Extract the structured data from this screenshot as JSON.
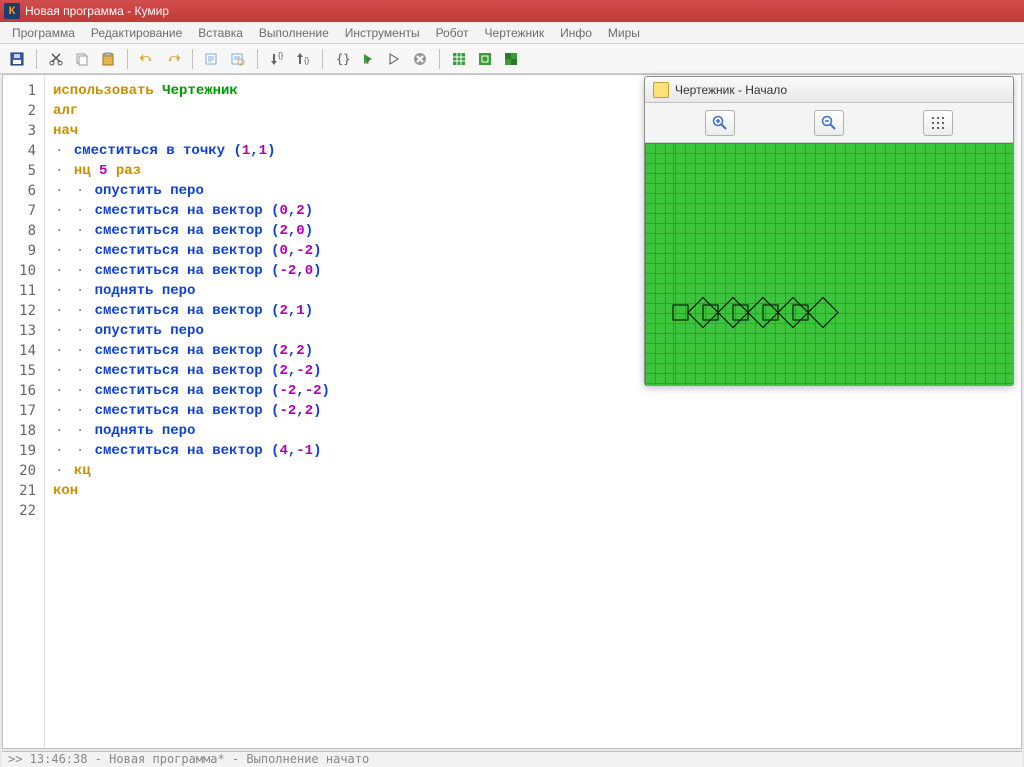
{
  "titlebar": {
    "icon_letter": "К",
    "title": "Новая программа - Кумир"
  },
  "menu": [
    "Программа",
    "Редактирование",
    "Вставка",
    "Выполнение",
    "Инструменты",
    "Робот",
    "Чертежник",
    "Инфо",
    "Миры"
  ],
  "toolbar_icons": [
    "save",
    "cut",
    "copy",
    "paste",
    "undo",
    "redo",
    "find",
    "replace",
    "step-into",
    "step-over",
    "braces",
    "run",
    "run-sel",
    "stop",
    "grid1",
    "grid2",
    "grid3"
  ],
  "code": {
    "lines": [
      {
        "n": 1,
        "tokens": [
          {
            "t": "kw",
            "v": "использовать "
          },
          {
            "t": "kw2",
            "v": "Чертежник"
          }
        ]
      },
      {
        "n": 2,
        "tokens": [
          {
            "t": "kw",
            "v": "алг"
          }
        ]
      },
      {
        "n": 3,
        "tokens": [
          {
            "t": "kw",
            "v": "нач"
          }
        ]
      },
      {
        "n": 4,
        "indent": 1,
        "tokens": [
          {
            "t": "cmd",
            "v": "сместиться в точку"
          },
          {
            "t": "txt",
            "v": " "
          },
          {
            "t": "op",
            "v": "("
          },
          {
            "t": "num",
            "v": "1"
          },
          {
            "t": "op",
            "v": ","
          },
          {
            "t": "num",
            "v": "1"
          },
          {
            "t": "op",
            "v": ")"
          }
        ]
      },
      {
        "n": 5,
        "indent": 1,
        "tokens": [
          {
            "t": "kw",
            "v": "нц "
          },
          {
            "t": "num",
            "v": "5"
          },
          {
            "t": "kw",
            "v": " раз"
          }
        ]
      },
      {
        "n": 6,
        "indent": 2,
        "tokens": [
          {
            "t": "cmd",
            "v": "опустить перо"
          }
        ]
      },
      {
        "n": 7,
        "indent": 2,
        "tokens": [
          {
            "t": "cmd",
            "v": "сместиться на вектор"
          },
          {
            "t": "txt",
            "v": " "
          },
          {
            "t": "op",
            "v": "("
          },
          {
            "t": "num",
            "v": "0"
          },
          {
            "t": "op",
            "v": ","
          },
          {
            "t": "num",
            "v": "2"
          },
          {
            "t": "op",
            "v": ")"
          }
        ]
      },
      {
        "n": 8,
        "indent": 2,
        "tokens": [
          {
            "t": "cmd",
            "v": "сместиться на вектор"
          },
          {
            "t": "txt",
            "v": " "
          },
          {
            "t": "op",
            "v": "("
          },
          {
            "t": "num",
            "v": "2"
          },
          {
            "t": "op",
            "v": ","
          },
          {
            "t": "num",
            "v": "0"
          },
          {
            "t": "op",
            "v": ")"
          }
        ]
      },
      {
        "n": 9,
        "indent": 2,
        "tokens": [
          {
            "t": "cmd",
            "v": "сместиться на вектор"
          },
          {
            "t": "txt",
            "v": " "
          },
          {
            "t": "op",
            "v": "("
          },
          {
            "t": "num",
            "v": "0"
          },
          {
            "t": "op",
            "v": ","
          },
          {
            "t": "num",
            "v": "-2"
          },
          {
            "t": "op",
            "v": ")"
          }
        ]
      },
      {
        "n": 10,
        "indent": 2,
        "tokens": [
          {
            "t": "cmd",
            "v": "сместиться на вектор"
          },
          {
            "t": "txt",
            "v": " "
          },
          {
            "t": "op",
            "v": "("
          },
          {
            "t": "num",
            "v": "-2"
          },
          {
            "t": "op",
            "v": ","
          },
          {
            "t": "num",
            "v": "0"
          },
          {
            "t": "op",
            "v": ")"
          }
        ]
      },
      {
        "n": 11,
        "indent": 2,
        "tokens": [
          {
            "t": "cmd",
            "v": "поднять перо"
          }
        ]
      },
      {
        "n": 12,
        "indent": 2,
        "tokens": [
          {
            "t": "cmd",
            "v": "сместиться на вектор"
          },
          {
            "t": "txt",
            "v": " "
          },
          {
            "t": "op",
            "v": "("
          },
          {
            "t": "num",
            "v": "2"
          },
          {
            "t": "op",
            "v": ","
          },
          {
            "t": "num",
            "v": "1"
          },
          {
            "t": "op",
            "v": ")"
          }
        ]
      },
      {
        "n": 13,
        "indent": 2,
        "tokens": [
          {
            "t": "cmd",
            "v": "опустить перо"
          }
        ]
      },
      {
        "n": 14,
        "indent": 2,
        "tokens": [
          {
            "t": "cmd",
            "v": "сместиться на вектор"
          },
          {
            "t": "txt",
            "v": " "
          },
          {
            "t": "op",
            "v": "("
          },
          {
            "t": "num",
            "v": "2"
          },
          {
            "t": "op",
            "v": ","
          },
          {
            "t": "num",
            "v": "2"
          },
          {
            "t": "op",
            "v": ")"
          }
        ]
      },
      {
        "n": 15,
        "indent": 2,
        "tokens": [
          {
            "t": "cmd",
            "v": "сместиться на вектор"
          },
          {
            "t": "txt",
            "v": " "
          },
          {
            "t": "op",
            "v": "("
          },
          {
            "t": "num",
            "v": "2"
          },
          {
            "t": "op",
            "v": ","
          },
          {
            "t": "num",
            "v": "-2"
          },
          {
            "t": "op",
            "v": ")"
          }
        ]
      },
      {
        "n": 16,
        "indent": 2,
        "tokens": [
          {
            "t": "cmd",
            "v": "сместиться на вектор"
          },
          {
            "t": "txt",
            "v": " "
          },
          {
            "t": "op",
            "v": "("
          },
          {
            "t": "num",
            "v": "-2"
          },
          {
            "t": "op",
            "v": ","
          },
          {
            "t": "num",
            "v": "-2"
          },
          {
            "t": "op",
            "v": ")"
          }
        ]
      },
      {
        "n": 17,
        "indent": 2,
        "tokens": [
          {
            "t": "cmd",
            "v": "сместиться на вектор"
          },
          {
            "t": "txt",
            "v": " "
          },
          {
            "t": "op",
            "v": "("
          },
          {
            "t": "num",
            "v": "-2"
          },
          {
            "t": "op",
            "v": ","
          },
          {
            "t": "num",
            "v": "2"
          },
          {
            "t": "op",
            "v": ")"
          }
        ]
      },
      {
        "n": 18,
        "indent": 2,
        "tokens": [
          {
            "t": "cmd",
            "v": "поднять перо"
          }
        ]
      },
      {
        "n": 19,
        "indent": 2,
        "tokens": [
          {
            "t": "cmd",
            "v": "сместиться на вектор"
          },
          {
            "t": "txt",
            "v": " "
          },
          {
            "t": "op",
            "v": "("
          },
          {
            "t": "num",
            "v": "4"
          },
          {
            "t": "op",
            "v": ","
          },
          {
            "t": "num",
            "v": "-1"
          },
          {
            "t": "op",
            "v": ")"
          }
        ]
      },
      {
        "n": 20,
        "indent": 1,
        "tokens": [
          {
            "t": "kw",
            "v": "кц"
          }
        ]
      },
      {
        "n": 21,
        "tokens": [
          {
            "t": "kw",
            "v": "кон"
          }
        ]
      },
      {
        "n": 22,
        "tokens": []
      }
    ]
  },
  "drawer": {
    "title": "Чертежник - Начало",
    "buttons": [
      "zoom-in",
      "zoom-out",
      "grid"
    ]
  },
  "status": ">> 13:46:38 - Новая программа* - Выполнение начато"
}
